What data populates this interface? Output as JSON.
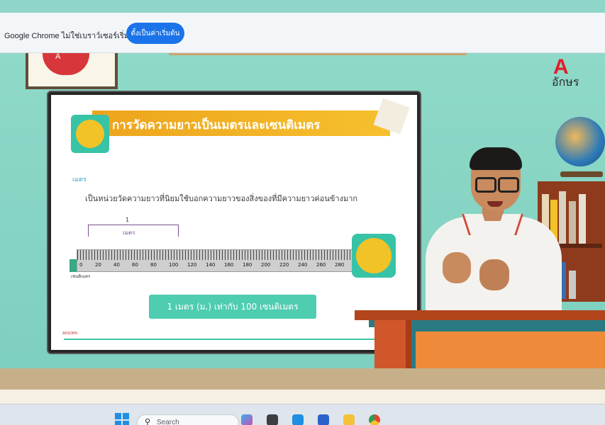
{
  "browser": {
    "infobar_message": "Google Chrome ไม่ใช่เบราว์เซอร์เริ่มต้น",
    "infobar_button": "ตั้งเป็นค่าเริ่มต้น"
  },
  "channel": {
    "logo_letter": "A",
    "name": "อักษร",
    "frame_logo_text": "A"
  },
  "slide": {
    "title": "การวัดความยาวเป็นเมตรและเซนติเมตร",
    "section_label": "เมตร",
    "definition": "เป็นหน่วยวัดความยาวที่นิยมใช้บอกความยาวของสิ่งของที่มีความยาวค่อนข้างมาก",
    "bracket_number": "1",
    "bracket_unit": "เมตร",
    "ruler_ticks": [
      "0",
      "20",
      "40",
      "60",
      "80",
      "100",
      "120",
      "140",
      "160",
      "180",
      "200",
      "220",
      "240",
      "260",
      "280"
    ],
    "ruler_unit": "เซนติเมตร",
    "formula": "1 เมตร (ม.) เท่ากับ 100 เซนติเมตร",
    "footer_logo": "AKSORN"
  },
  "taskbar": {
    "search_placeholder": "Search"
  }
}
